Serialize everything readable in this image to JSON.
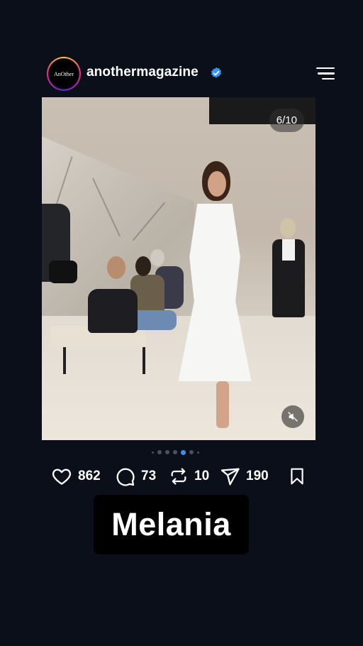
{
  "post": {
    "username": "anothermagazine",
    "avatar_text": "AnOther",
    "verified": true,
    "media_counter": "6/10",
    "carousel": {
      "total_dots": 7,
      "active_index": 4
    },
    "actions": {
      "likes": "862",
      "comments": "73",
      "reposts": "10",
      "shares": "190"
    },
    "caption_overlay": "Melania"
  },
  "icons": {
    "menu": "menu-lines-icon",
    "verified": "verified-badge-icon",
    "mute": "muted-speaker-icon",
    "like": "heart-icon",
    "comment": "comment-bubble-icon",
    "repost": "repost-icon",
    "share": "send-icon",
    "save": "bookmark-icon"
  },
  "colors": {
    "background": "#0b0f19",
    "accent": "#3a8cff",
    "verified": "#3897f0"
  }
}
